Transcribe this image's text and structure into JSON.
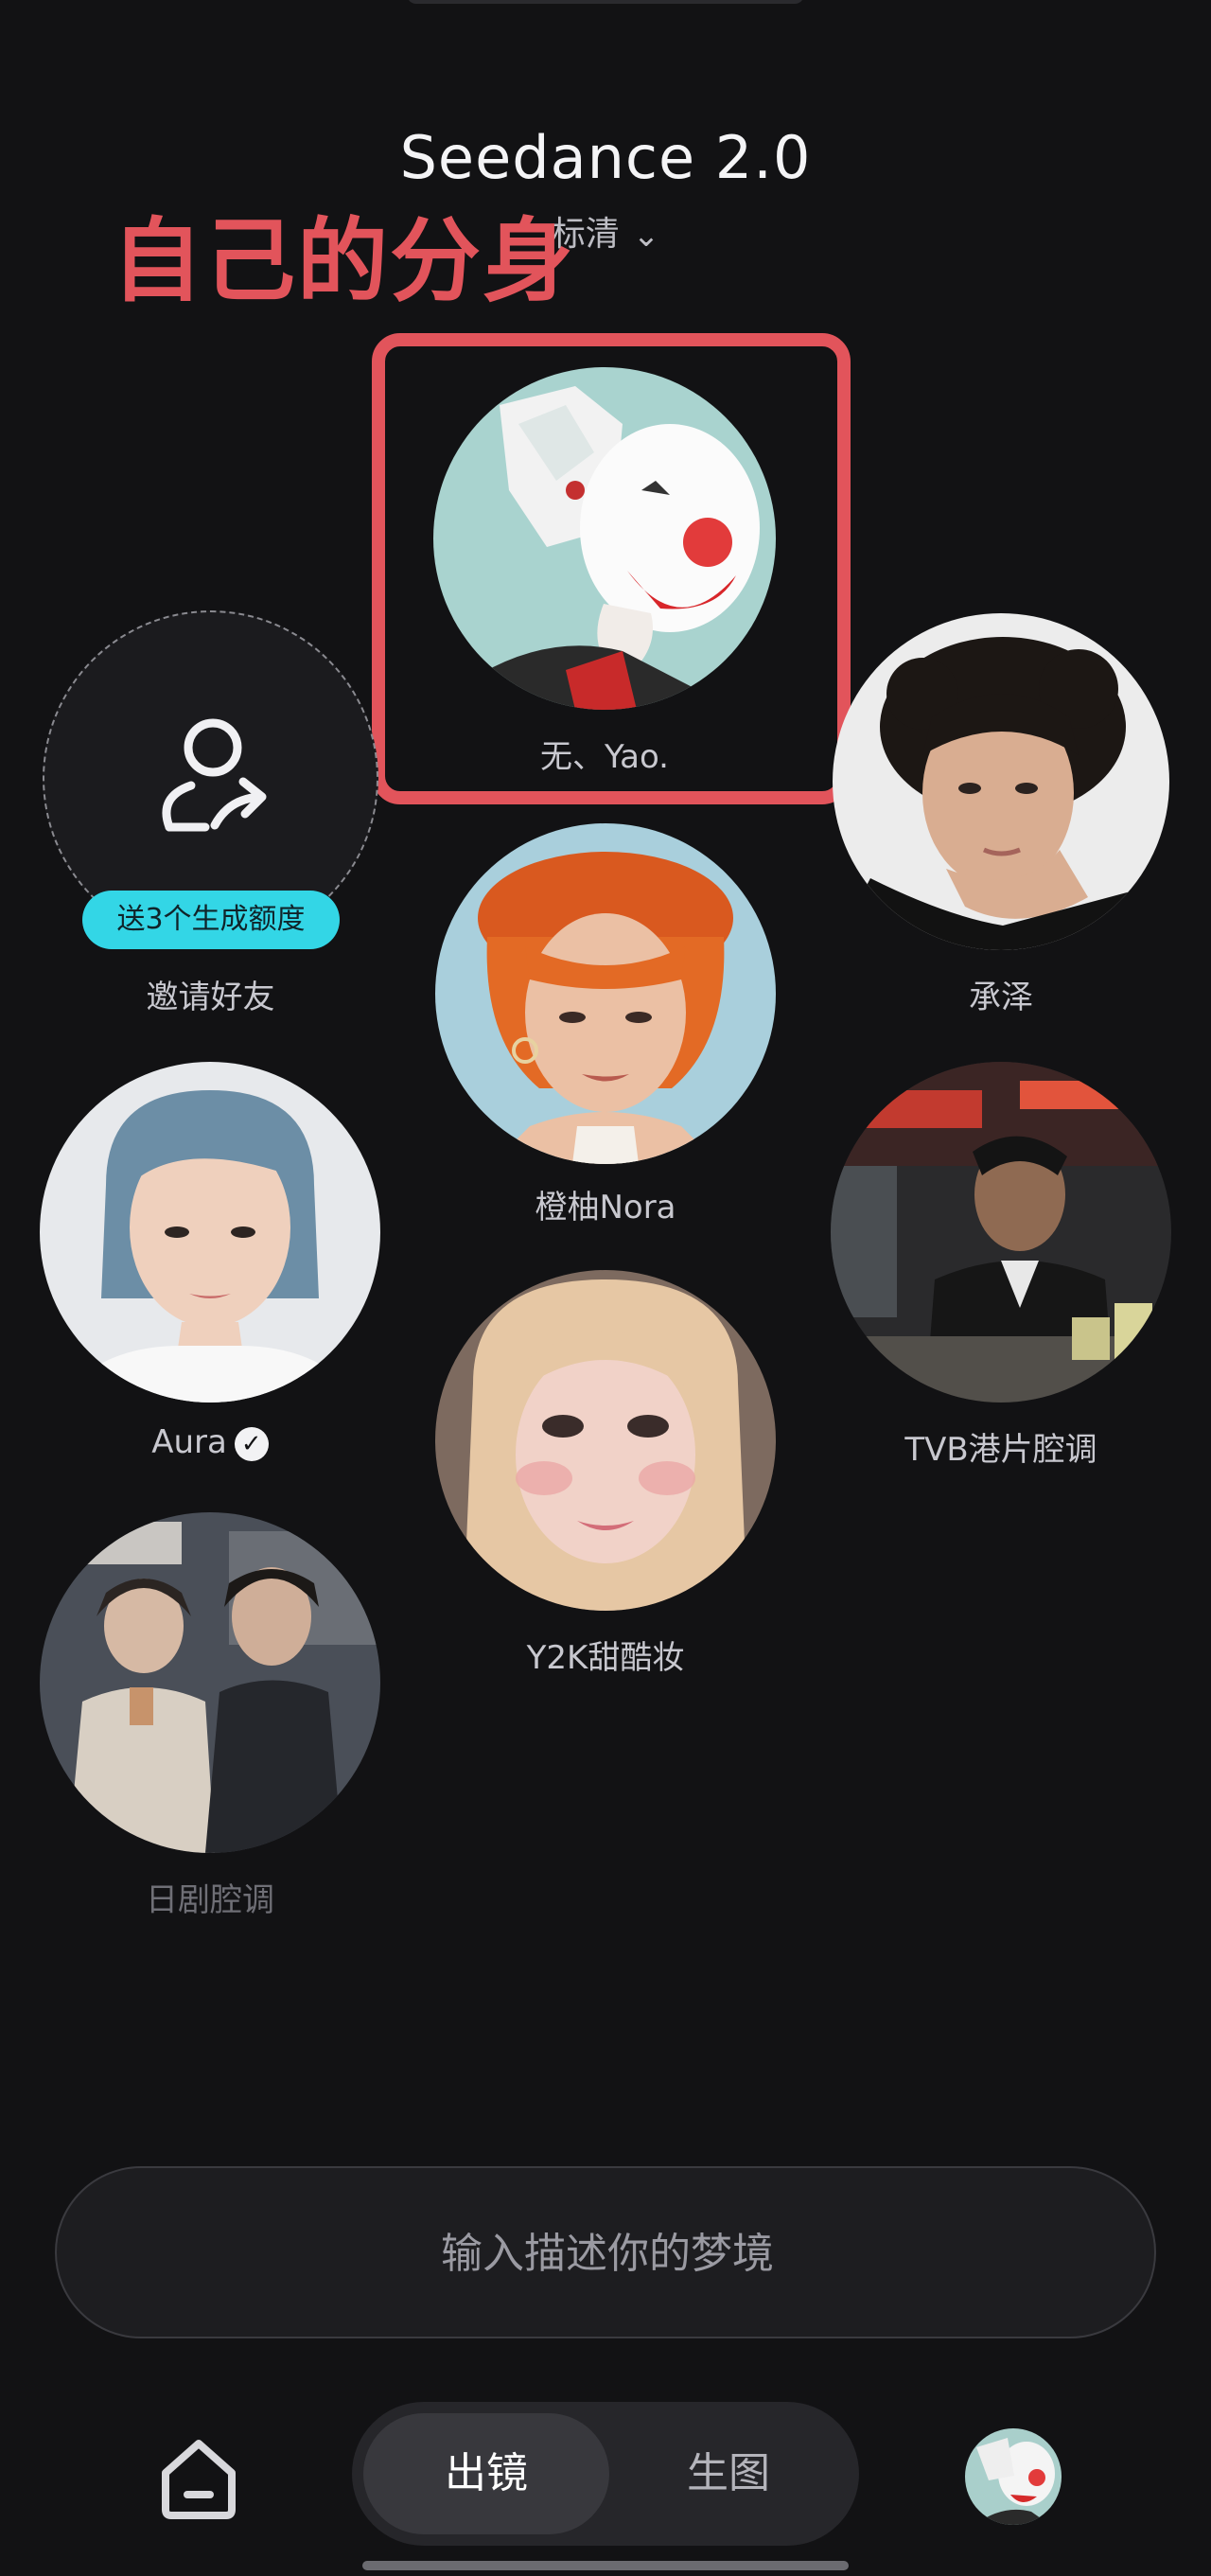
{
  "header": {
    "title": "Seedance 2.0",
    "quality_label": "标清",
    "annotation": "自己的分身"
  },
  "invite": {
    "label": "邀请好友",
    "badge": "送3个生成额度"
  },
  "avatars": [
    {
      "name": "无、Yao.",
      "icon": "clown-mask-anime-avatar"
    },
    {
      "name": "承泽",
      "icon": "curly-hair-man-portrait"
    },
    {
      "name": "橙柚Nora",
      "icon": "orange-beret-woman-portrait"
    },
    {
      "name": "Aura",
      "icon": "blue-hair-woman-portrait",
      "verified": true
    },
    {
      "name": "TVB港片腔调",
      "icon": "hk-film-scene"
    },
    {
      "name": "Y2K甜酷妆",
      "icon": "y2k-makeup-portrait"
    },
    {
      "name": "日剧腔调",
      "icon": "jdrama-couple-scene"
    }
  ],
  "prompt": {
    "placeholder": "输入描述你的梦境"
  },
  "tabs": {
    "active": "出镜",
    "inactive": "生图"
  },
  "colors": {
    "background": "#121214",
    "annotation_red": "#e2545b",
    "badge_cyan": "#33d6e6"
  }
}
